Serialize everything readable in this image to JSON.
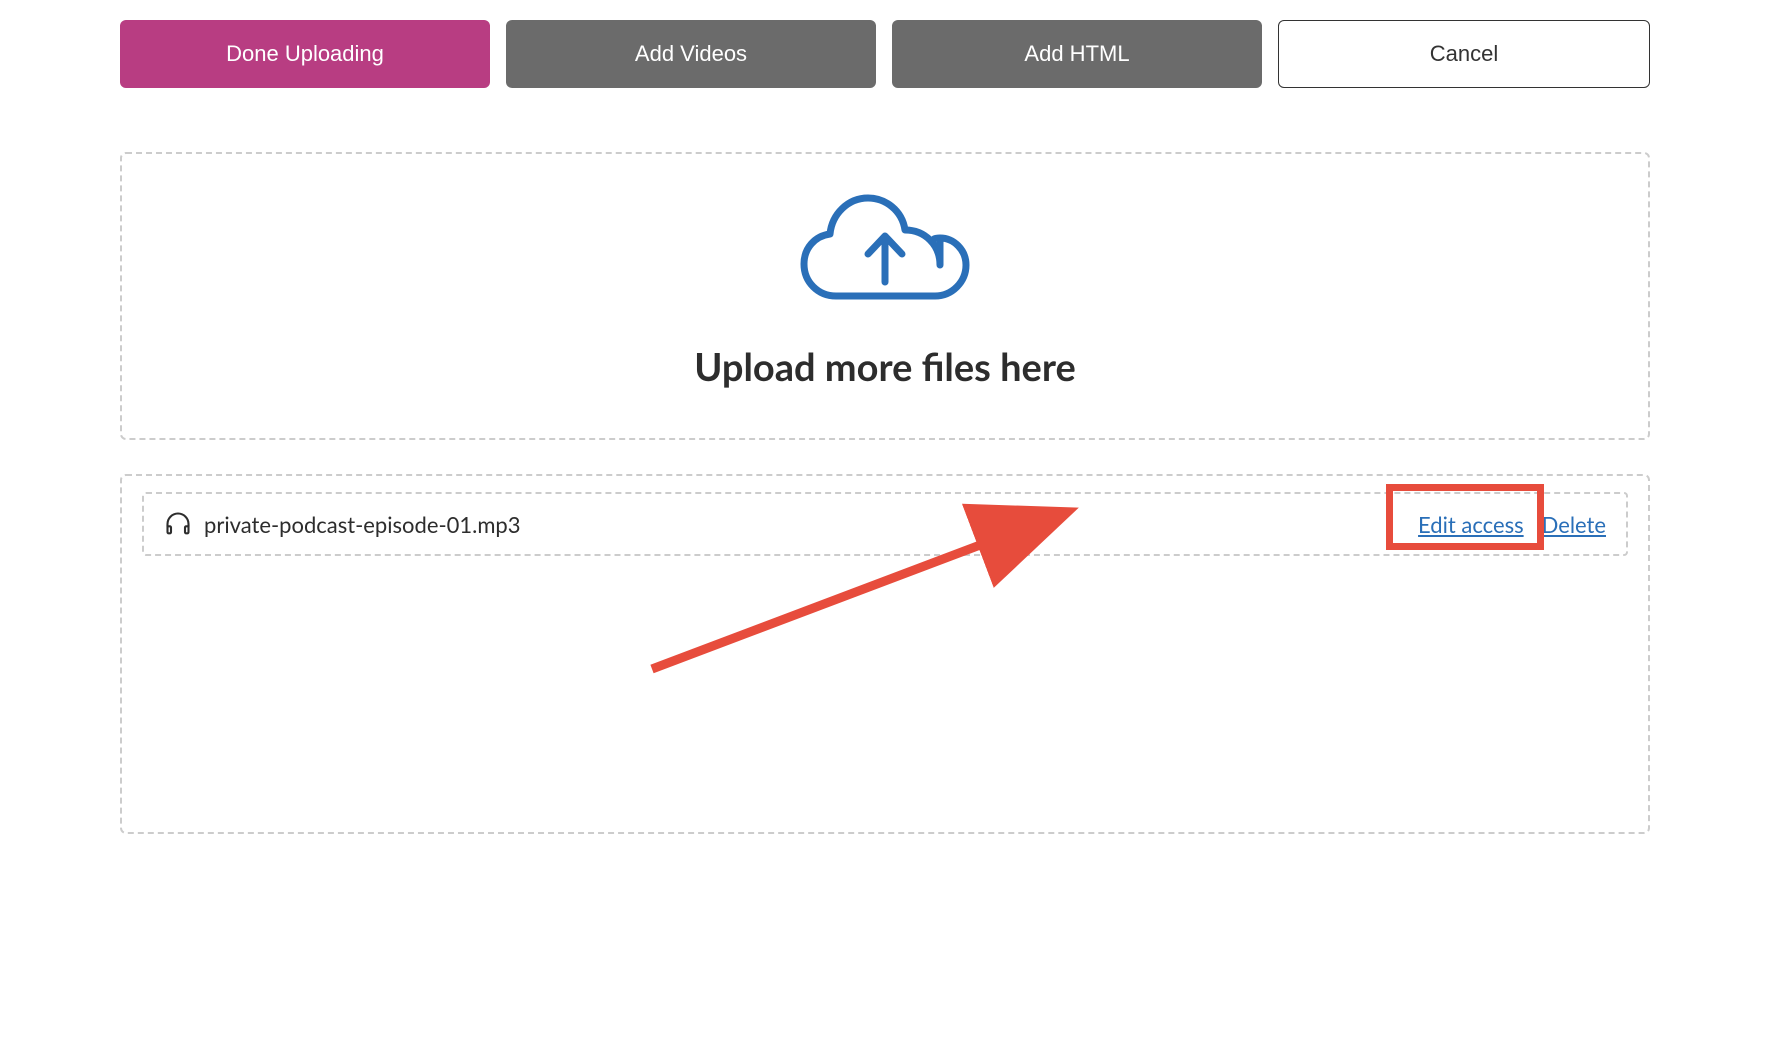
{
  "toolbar": {
    "done_uploading_label": "Done Uploading",
    "add_videos_label": "Add Videos",
    "add_html_label": "Add HTML",
    "cancel_label": "Cancel"
  },
  "dropzone": {
    "title": "Upload more files here"
  },
  "files": [
    {
      "name": "private-podcast-episode-01.mp3",
      "edit_access_label": "Edit access",
      "delete_label": "Delete"
    }
  ],
  "colors": {
    "primary": "#b83d82",
    "secondary": "#6b6b6b",
    "link": "#2a6fb8",
    "annotation": "#e74c3c",
    "cloud": "#2a6fb8"
  }
}
